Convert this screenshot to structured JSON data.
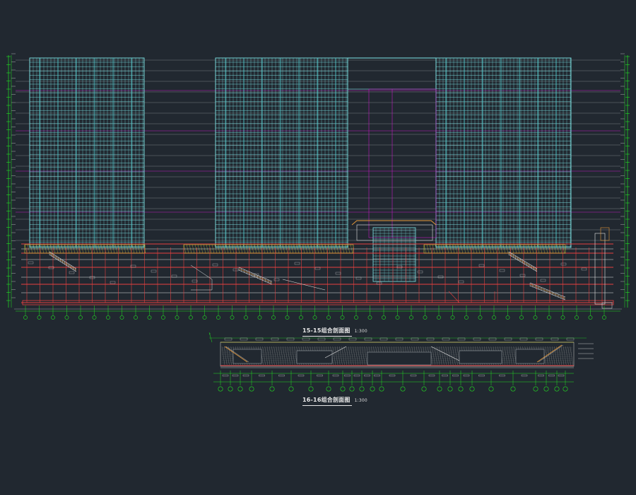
{
  "drawing": {
    "background": "#212830",
    "colors": {
      "curtain_wall": "#7fe6e8",
      "structure_red": "#e64040",
      "floor_magenta": "#c21cc2",
      "dimension_green": "#22e022",
      "text_white": "#e6e6e6",
      "wall_yellow": "#e8e23a",
      "hatch_grey": "#8a8a8a",
      "accent_orange": "#e89a3a"
    },
    "section_15": {
      "title": "15-15组合剖面图",
      "scale": "1:300"
    },
    "section_16": {
      "title": "16-16组合剖面图",
      "scale": "1:300"
    }
  }
}
